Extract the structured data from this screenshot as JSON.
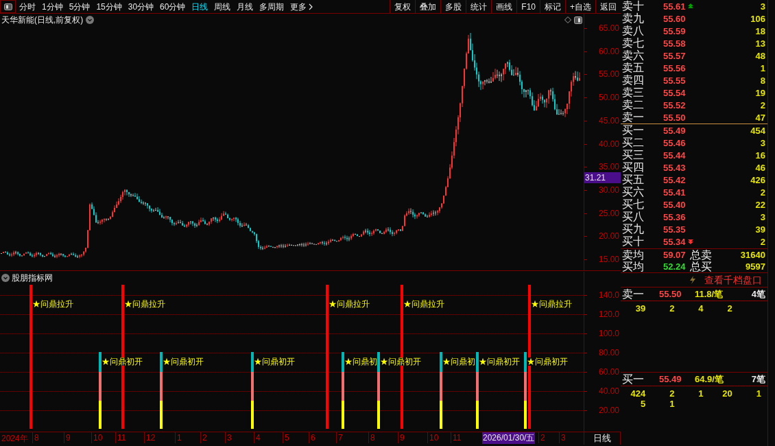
{
  "toolbar": {
    "periods": [
      {
        "label": "分时",
        "selected": false
      },
      {
        "label": "1分钟",
        "selected": false
      },
      {
        "label": "5分钟",
        "selected": false
      },
      {
        "label": "15分钟",
        "selected": false
      },
      {
        "label": "30分钟",
        "selected": false
      },
      {
        "label": "60分钟",
        "selected": false
      },
      {
        "label": "日线",
        "selected": true
      },
      {
        "label": "周线",
        "selected": false
      },
      {
        "label": "月线",
        "selected": false
      },
      {
        "label": "多周期",
        "selected": false
      },
      {
        "label": "更多",
        "selected": false
      }
    ],
    "buttons": [
      "复权",
      "叠加",
      "多股",
      "统计",
      "画线",
      "F10",
      "标记",
      "+自选",
      "返回"
    ]
  },
  "chart": {
    "title": "天华新能(日线,前复权)",
    "price_axis": [
      "65.00",
      "60.00",
      "55.00",
      "50.00",
      "45.00",
      "40.00",
      "35.00",
      "30.00",
      "25.00",
      "20.00",
      "15.00"
    ],
    "current_price": "31.21"
  },
  "indicator": {
    "title": "股朋指标网",
    "axis": [
      "140.0",
      "120.0",
      "100.0",
      "80.00",
      "60.00",
      "40.00",
      "20.00"
    ],
    "signals": [
      {
        "kind": "rise",
        "label": "★问鼎拉升"
      },
      {
        "kind": "rise",
        "label": "★问鼎拉升"
      },
      {
        "kind": "rise",
        "label": "★问鼎拉升"
      },
      {
        "kind": "rise",
        "label": "★问鼎拉升"
      },
      {
        "kind": "rise",
        "label": "★问鼎拉升"
      },
      {
        "kind": "start",
        "label": "★问鼎初开"
      },
      {
        "kind": "start",
        "label": "★问鼎初开"
      },
      {
        "kind": "start",
        "label": "★问鼎初开"
      },
      {
        "kind": "start",
        "label": "★问鼎初"
      },
      {
        "kind": "start",
        "label": "★问鼎初开"
      },
      {
        "kind": "start",
        "label": "★问鼎初"
      },
      {
        "kind": "start",
        "label": "★问鼎初开"
      },
      {
        "kind": "start",
        "label": "★问鼎初开"
      }
    ]
  },
  "time_axis": {
    "year": "2024年",
    "months": [
      "8",
      "9",
      "10",
      "11",
      "12",
      "1",
      "2",
      "3",
      "4",
      "5",
      "6",
      "7",
      "8",
      "9",
      "10",
      "11",
      "2",
      "3"
    ],
    "cursor_date": "2026/01/30/五",
    "period": "日线"
  },
  "order_book": {
    "asks": [
      {
        "label": "卖十",
        "price": "55.61",
        "volume": "3",
        "up_arrow": true
      },
      {
        "label": "卖九",
        "price": "55.60",
        "volume": "106",
        "up_arrow": false
      },
      {
        "label": "卖八",
        "price": "55.59",
        "volume": "18",
        "up_arrow": false
      },
      {
        "label": "卖七",
        "price": "55.58",
        "volume": "13",
        "up_arrow": false
      },
      {
        "label": "卖六",
        "price": "55.57",
        "volume": "48",
        "up_arrow": false
      },
      {
        "label": "卖五",
        "price": "55.56",
        "volume": "1",
        "up_arrow": false
      },
      {
        "label": "卖四",
        "price": "55.55",
        "volume": "8",
        "up_arrow": false
      },
      {
        "label": "卖三",
        "price": "55.54",
        "volume": "19",
        "up_arrow": false
      },
      {
        "label": "卖二",
        "price": "55.52",
        "volume": "2",
        "up_arrow": false
      },
      {
        "label": "卖一",
        "price": "55.50",
        "volume": "47",
        "up_arrow": false
      }
    ],
    "bids": [
      {
        "label": "买一",
        "price": "55.49",
        "volume": "454",
        "down_arrow": false
      },
      {
        "label": "买二",
        "price": "55.46",
        "volume": "3",
        "down_arrow": false
      },
      {
        "label": "买三",
        "price": "55.44",
        "volume": "16",
        "down_arrow": false
      },
      {
        "label": "买四",
        "price": "55.43",
        "volume": "46",
        "down_arrow": false
      },
      {
        "label": "买五",
        "price": "55.42",
        "volume": "426",
        "down_arrow": false
      },
      {
        "label": "买六",
        "price": "55.41",
        "volume": "2",
        "down_arrow": false
      },
      {
        "label": "买七",
        "price": "55.40",
        "volume": "22",
        "down_arrow": false
      },
      {
        "label": "买八",
        "price": "55.36",
        "volume": "3",
        "down_arrow": false
      },
      {
        "label": "买九",
        "price": "55.35",
        "volume": "39",
        "down_arrow": false
      },
      {
        "label": "买十",
        "price": "55.34",
        "volume": "2",
        "down_arrow": true
      }
    ],
    "summary": [
      {
        "kind": "sell",
        "label": "卖均",
        "price": "59.07",
        "total_label": "总卖",
        "total": "31640"
      },
      {
        "kind": "buy",
        "label": "买均",
        "price": "52.24",
        "total_label": "总买",
        "total": "9597"
      }
    ]
  },
  "queue": {
    "link": "查看千档盘口",
    "levels": [
      {
        "label": "卖一",
        "price": "55.50",
        "average": "11.8/笔",
        "count": "4笔",
        "orders": [
          "39",
          "2",
          "4",
          "2"
        ]
      },
      {
        "label": "买一",
        "price": "55.49",
        "average": "64.9/笔",
        "count": "7笔",
        "orders": [
          "424",
          "2",
          "1",
          "20",
          "1",
          "5",
          "1"
        ]
      }
    ]
  }
}
